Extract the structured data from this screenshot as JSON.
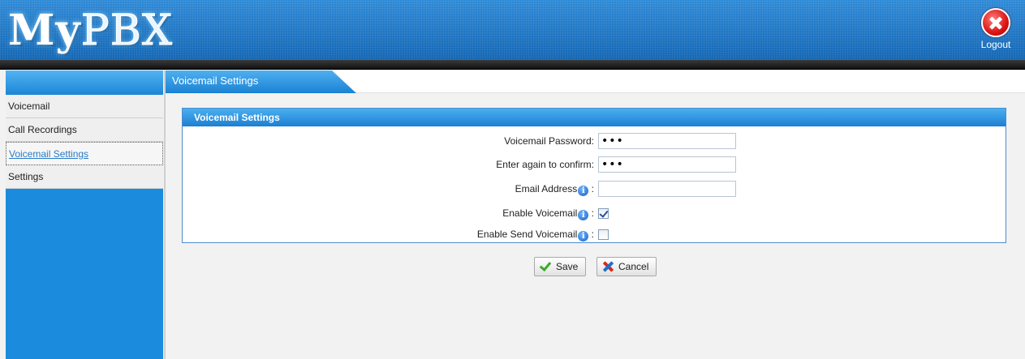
{
  "header": {
    "logo_my": "My",
    "logo_pbx": "PBX",
    "logout_label": "Logout"
  },
  "sidebar": {
    "items": [
      {
        "label": "Voicemail"
      },
      {
        "label": "Call Recordings"
      },
      {
        "label": "Voicemail Settings",
        "active": true
      },
      {
        "label": "Settings"
      }
    ]
  },
  "tab": {
    "label": "Voicemail Settings"
  },
  "panel": {
    "title": "Voicemail Settings",
    "fields": {
      "password_label": "Voicemail Password:",
      "password_value": "•••",
      "confirm_label": "Enter again to confirm:",
      "confirm_value": "•••",
      "email_label": "Email Address",
      "email_value": "",
      "enable_label": "Enable Voicemail",
      "enable_checked": true,
      "send_label": "Enable Send Voicemail",
      "send_checked": false,
      "colon": ":"
    }
  },
  "buttons": {
    "save_label": "Save",
    "cancel_label": "Cancel"
  },
  "icons": {
    "info_glyph": "i"
  },
  "colors": {
    "brand_blue": "#1a8bdd",
    "header_dark": "#1a1a1a",
    "active_link": "#2a7bc8"
  }
}
